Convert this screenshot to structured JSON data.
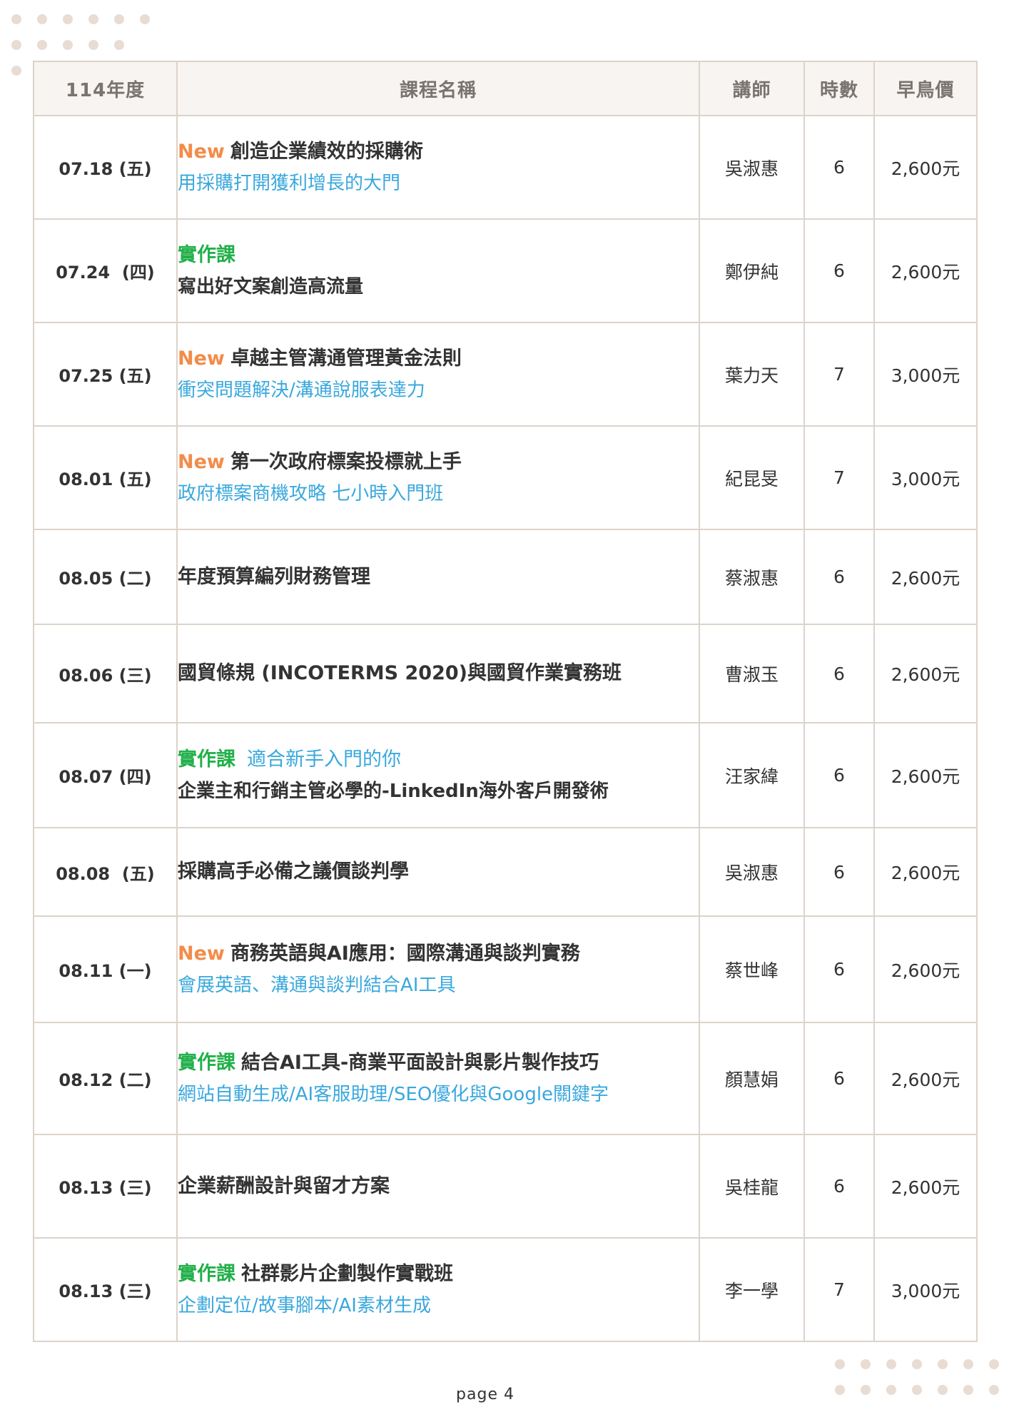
{
  "header": {
    "year": "114年度",
    "course": "課程名稱",
    "teacher": "講師",
    "hours": "時數",
    "price": "早鳥價"
  },
  "rows": [
    {
      "date": "07.18 (五)",
      "tag": "New",
      "tag_sub": "",
      "title": "創造企業績效的採購術",
      "subtitle": "用採購打開獲利增長的大門",
      "teacher": "吳淑惠",
      "hours": "6",
      "price": "2,600元"
    },
    {
      "date": "07.24  (四)",
      "tag": "實作課",
      "tag_sub": "",
      "title": "",
      "subtitle": "寫出好文案創造高流量",
      "teacher": "鄭伊純",
      "hours": "6",
      "price": "2,600元"
    },
    {
      "date": "07.25 (五)",
      "tag": "New",
      "tag_sub": "",
      "title": "卓越主管溝通管理黃金法則",
      "subtitle": "衝突問題解決/溝通說服表達力",
      "teacher": "葉力天",
      "hours": "7",
      "price": "3,000元"
    },
    {
      "date": "08.01 (五)",
      "tag": "New",
      "tag_sub": "",
      "title": "第一次政府標案投標就上手",
      "subtitle": "政府標案商機攻略 七小時入門班",
      "teacher": "紀昆旻",
      "hours": "7",
      "price": "3,000元"
    },
    {
      "date": "08.05 (二)",
      "tag": "",
      "tag_sub": "",
      "title": "年度預算編列財務管理",
      "subtitle": "",
      "teacher": "蔡淑惠",
      "hours": "6",
      "price": "2,600元"
    },
    {
      "date": "08.06 (三)",
      "tag": "",
      "tag_sub": "",
      "title": "國貿條規 (INCOTERMS 2020)與國貿作業實務班",
      "subtitle": "",
      "teacher": "曹淑玉",
      "hours": "6",
      "price": "2,600元"
    },
    {
      "date": "08.07 (四)",
      "tag": "實作課",
      "tag_sub": "適合新手入門的你",
      "title": "",
      "subtitle": "企業主和行銷主管必學的-LinkedIn海外客戶開發術",
      "teacher": "汪家緯",
      "hours": "6",
      "price": "2,600元"
    },
    {
      "date": "08.08  (五)",
      "tag": "",
      "tag_sub": "",
      "title": "採購高手必備之議價談判學",
      "subtitle": "",
      "teacher": "吳淑惠",
      "hours": "6",
      "price": "2,600元"
    },
    {
      "date": "08.11 (一)",
      "tag": "New",
      "tag_sub": "",
      "title": "商務英語與AI應用：國際溝通與談判實務",
      "subtitle": "會展英語、溝通與談判結合AI工具",
      "teacher": "蔡世峰",
      "hours": "6",
      "price": "2,600元"
    },
    {
      "date": "08.12 (二)",
      "tag": "實作課",
      "tag_sub": "",
      "title": "結合AI工具-商業平面設計與影片製作技巧",
      "subtitle": "網站自動生成/AI客服助理/SEO優化與Google關鍵字",
      "teacher": "顏慧娟",
      "hours": "6",
      "price": "2,600元"
    },
    {
      "date": "08.13 (三)",
      "tag": "",
      "tag_sub": "",
      "title": "企業薪酬設計與留才方案",
      "subtitle": "",
      "teacher": "吳桂龍",
      "hours": "6",
      "price": "2,600元"
    },
    {
      "date": "08.13 (三)",
      "tag": "實作課",
      "tag_sub": "",
      "title": "社群影片企劃製作實戰班",
      "subtitle": "企劃定位/故事腳本/AI素材生成",
      "teacher": "李一學",
      "hours": "7",
      "price": "3,000元"
    }
  ],
  "footer": {
    "page": "page 4"
  },
  "colors": {
    "new": "#f28c4a",
    "practice": "#22b04a",
    "subtitle": "#3aa8dd",
    "border": "#dcd3ca",
    "dot": "#e8dcd3"
  }
}
